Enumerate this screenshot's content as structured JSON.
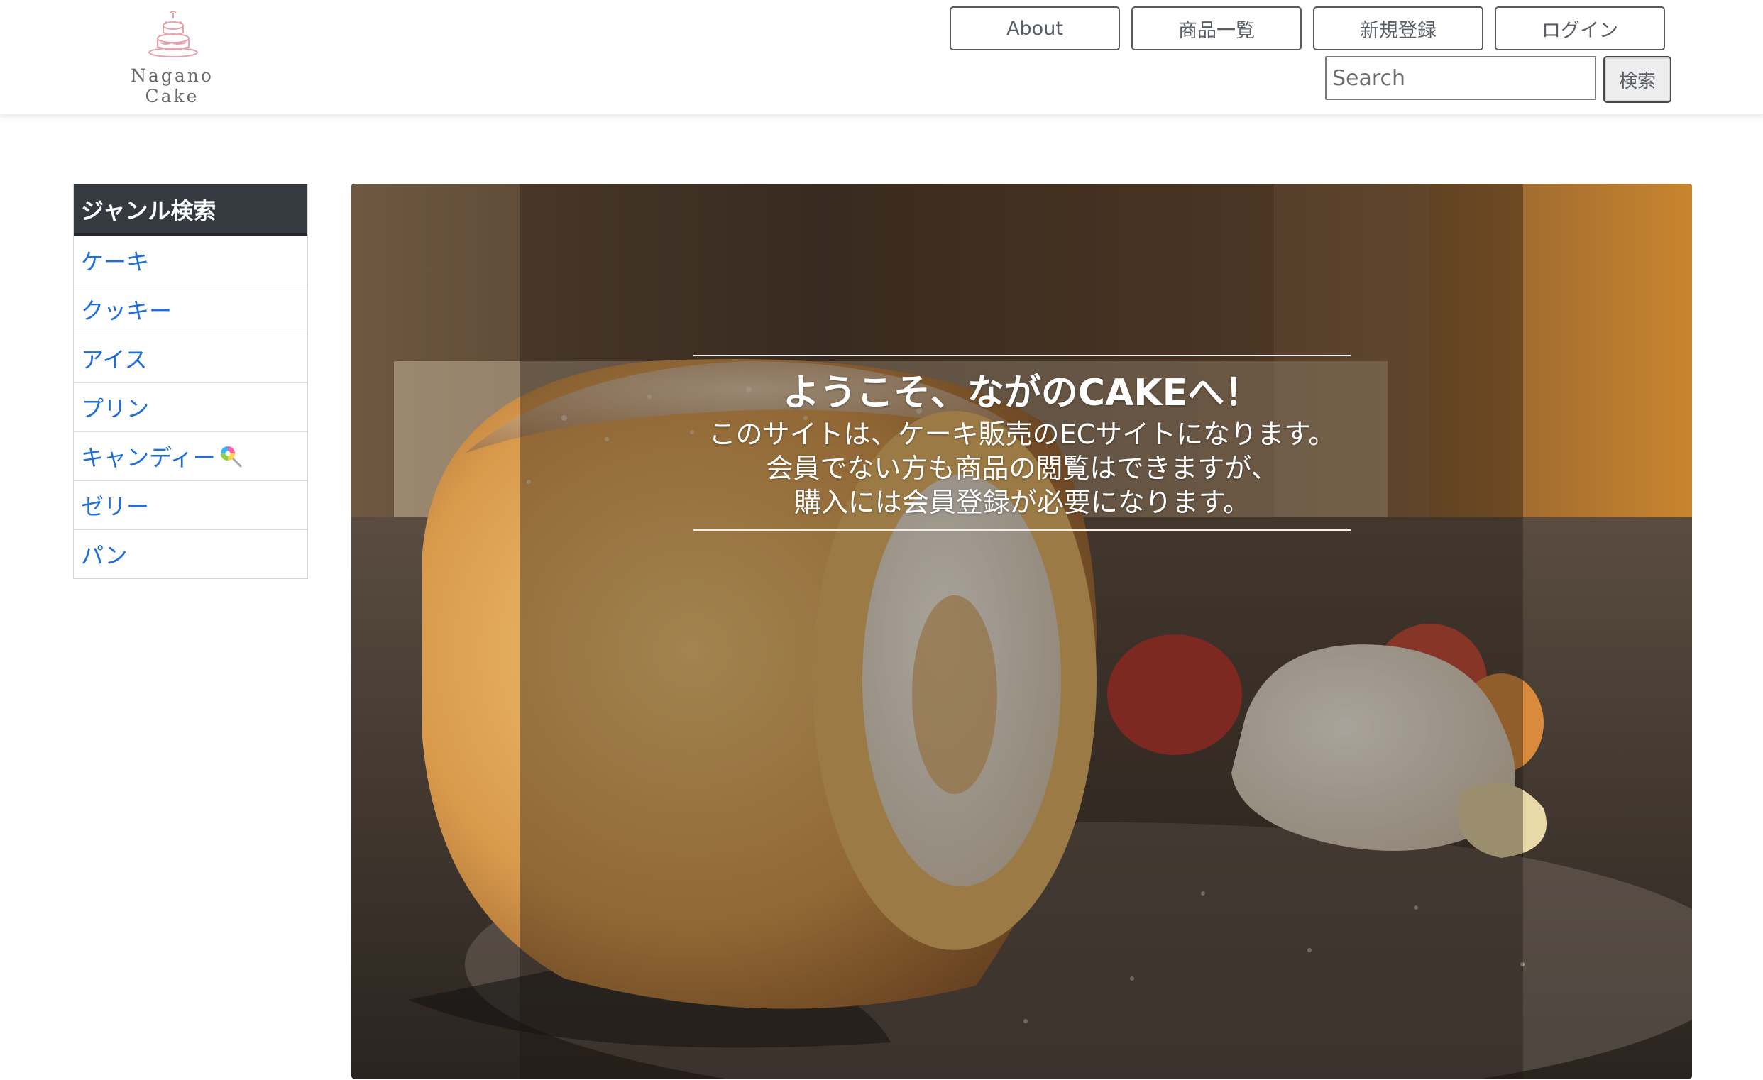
{
  "header": {
    "logo_text": "Nagano Cake",
    "nav": [
      "About",
      "商品一覧",
      "新規登録",
      "ログイン"
    ],
    "search": {
      "placeholder": "Search",
      "button_label": "検索"
    }
  },
  "sidebar": {
    "title": "ジャンル検索",
    "items": [
      {
        "label": "ケーキ"
      },
      {
        "label": "クッキー"
      },
      {
        "label": "アイス"
      },
      {
        "label": "プリン"
      },
      {
        "label": "キャンディー",
        "icon": "lollipop-icon"
      },
      {
        "label": "ゼリー"
      },
      {
        "label": "パン"
      }
    ]
  },
  "hero": {
    "title": "ようこそ、ながのCAKEへ！",
    "lines": [
      "このサイトは、ケーキ販売のECサイトになります。",
      "会員でない方も商品の閲覧はできますが、",
      "購入には会員登録が必要になります。"
    ]
  },
  "colors": {
    "sidebar_header_bg": "#343a40",
    "link_blue": "#1e6fd9",
    "logo_pink": "#e8a4ad"
  }
}
